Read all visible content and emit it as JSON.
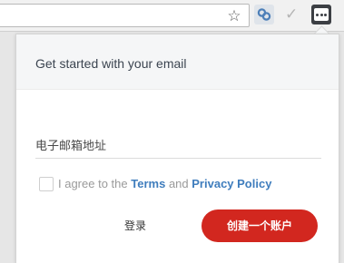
{
  "toolbar": {
    "bookmark_icon": "star-icon",
    "extensions": [
      "link-extension-icon",
      "check-extension-icon",
      "ellipsis-extension-icon"
    ]
  },
  "popup": {
    "title": "Get started with your email",
    "email_placeholder": "电子邮箱地址",
    "agree_prefix": "I agree to the",
    "terms_link": "Terms",
    "and_text": "and",
    "privacy_link": "Privacy Policy",
    "login_label": "登录",
    "signup_label": "创建一个账户"
  },
  "colors": {
    "primary_button": "#d2271f",
    "link": "#3f7dbd",
    "header_bg": "#f5f6f7"
  }
}
